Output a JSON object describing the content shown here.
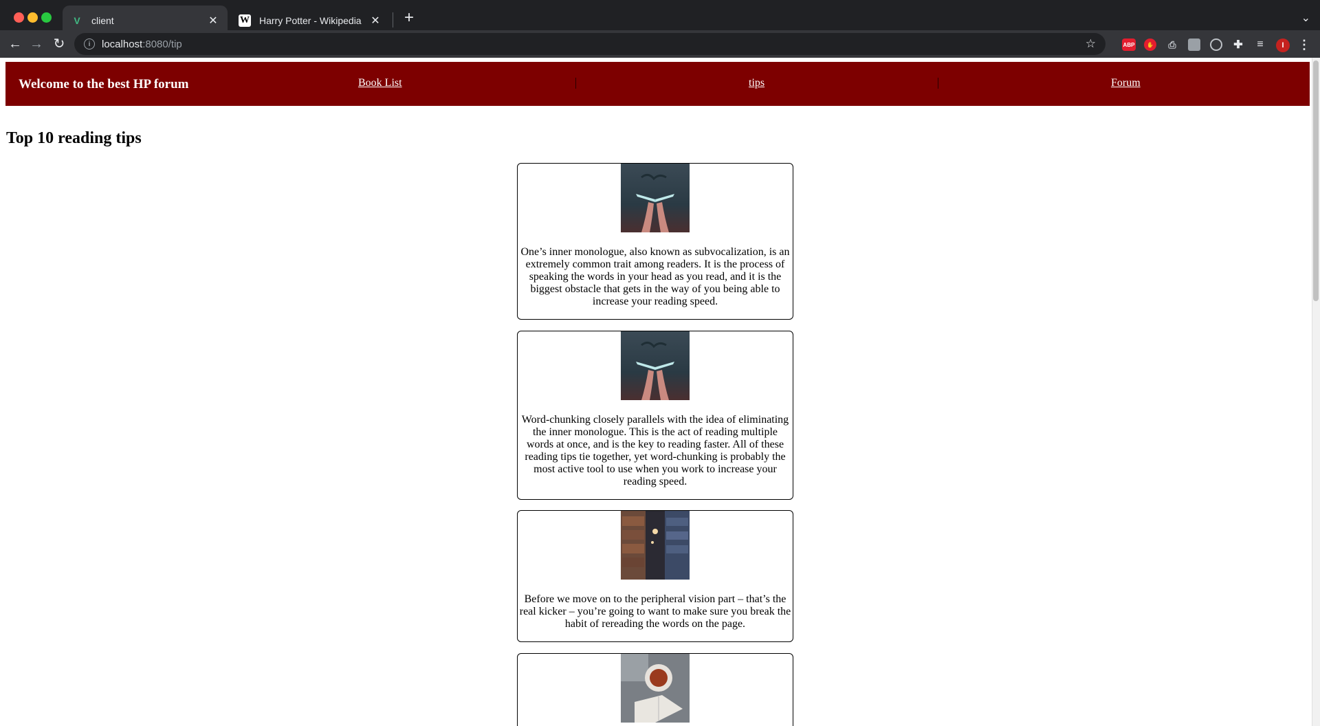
{
  "browser": {
    "tabs": [
      {
        "title": "client",
        "favicon": "V",
        "active": true
      },
      {
        "title": "Harry Potter - Wikipedia",
        "favicon": "W",
        "active": false
      }
    ],
    "address": {
      "host": "localhost",
      "path": ":8080/tip"
    },
    "extensions": {
      "abp_label": "ABP",
      "profile_initial": "I"
    }
  },
  "site": {
    "title": "Welcome to the best HP forum",
    "nav": {
      "books": "Book List",
      "tips": "tips",
      "forum": "Forum"
    },
    "header_color": "#7d0000"
  },
  "main": {
    "heading": "Top 10 reading tips",
    "tips": [
      {
        "image": "hands-holding-glowing-book",
        "text": "One’s inner monologue, also known as subvocalization, is an extremely common trait among readers. It is the process of speaking the words in your head as you read, and it is the biggest obstacle that gets in the way of you being able to increase your reading speed."
      },
      {
        "image": "hands-holding-glowing-book",
        "text": "Word-chunking closely parallels with the idea of eliminating the inner monologue. This is the act of reading multiple words at once, and is the key to reading faster. All of these reading tips tie together, yet word-chunking is probably the most active tool to use when you work to increase your reading speed."
      },
      {
        "image": "library-bookshelves",
        "text": "Before we move on to the peripheral vision part – that’s the real kicker – you’re going to want to make sure you break the habit of rereading the words on the page."
      },
      {
        "image": "tea-cup-and-open-book",
        "text": ""
      }
    ]
  }
}
